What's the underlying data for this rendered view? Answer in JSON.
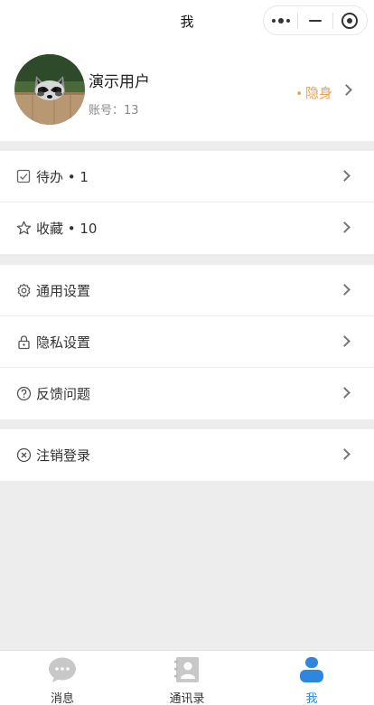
{
  "navbar": {
    "title": "我",
    "capsule": {
      "menu_icon": "more-dots-icon",
      "minimize_icon": "minimize-icon",
      "close_icon": "target-circle-icon"
    }
  },
  "profile": {
    "avatar_icon": "raccoon-avatar",
    "name": "演示用户",
    "account": "账号：13",
    "status_dot": "•",
    "status": "隐身",
    "status_color": "#e6a15a"
  },
  "groups": [
    {
      "items": [
        {
          "label": "待办 • 1",
          "icon": "checkbox-icon"
        },
        {
          "label": "收藏 • 10",
          "icon": "star-icon"
        }
      ]
    },
    {
      "items": [
        {
          "label": "通用设置",
          "icon": "gear-icon"
        },
        {
          "label": "隐私设置",
          "icon": "lock-icon"
        },
        {
          "label": "反馈问题",
          "icon": "question-circle-icon"
        }
      ]
    },
    {
      "items": [
        {
          "label": "注销登录",
          "icon": "close-circle-icon"
        }
      ]
    }
  ],
  "tabbar": {
    "tabs": [
      {
        "label": "消息",
        "icon": "chat-bubble-icon",
        "active": false
      },
      {
        "label": "通讯录",
        "icon": "contacts-book-icon",
        "active": false
      },
      {
        "label": "我",
        "icon": "user-icon",
        "active": true
      }
    ],
    "active_color": "#2e86de"
  }
}
